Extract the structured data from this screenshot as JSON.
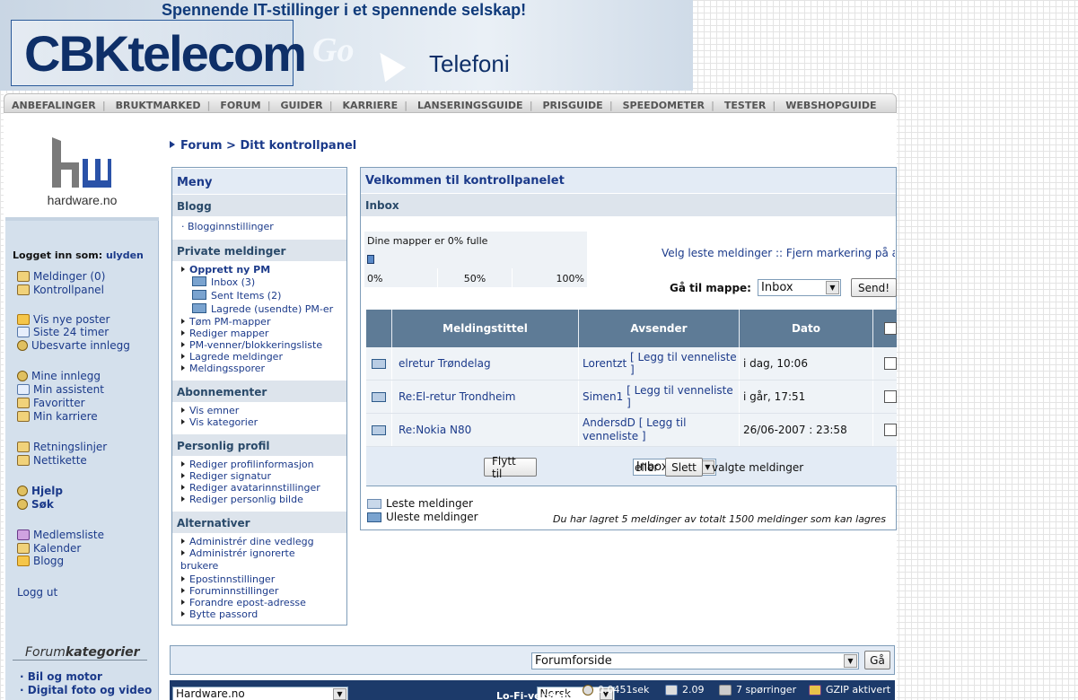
{
  "banner": {
    "tagline": "Spennende IT-stillinger i et spennende selskap!",
    "company": "CBKtelecom",
    "go": "Go",
    "product": "Telefoni"
  },
  "topnav": [
    "ANBEFALINGER",
    "BRUKTMARKED",
    "FORUM",
    "GUIDER",
    "KARRIERE",
    "LANSERINGSGUIDE",
    "PRISGUIDE",
    "SPEEDOMETER",
    "TESTER",
    "WEBSHOPGUIDE"
  ],
  "sidebar": {
    "logo_text": "hardware.no",
    "logged_in_label": "Logget inn som:",
    "username": "ulyden",
    "group1": [
      "Meldinger (0)",
      "Kontrollpanel"
    ],
    "group2": [
      "Vis nye poster",
      "Siste 24 timer",
      "Ubesvarte innlegg"
    ],
    "group3": [
      "Mine innlegg",
      "Min assistent",
      "Favoritter",
      "Min karriere"
    ],
    "group4": [
      "Retningslinjer",
      "Nettikette"
    ],
    "group5": [
      "Hjelp",
      "Søk"
    ],
    "group6": [
      "Medlemsliste",
      "Kalender",
      "Blogg"
    ],
    "logout": "Logg ut",
    "forumcat_title_a": "Forum",
    "forumcat_title_b": "kategorier",
    "forumcats": [
      "Bil og motor",
      "Digital foto og video"
    ]
  },
  "breadcrumb": {
    "root": "Forum",
    "sep": ">",
    "current": "Ditt kontrollpanel"
  },
  "menu": {
    "title": "Meny",
    "blogg": {
      "header": "Blogg",
      "items": [
        "Blogginnstillinger"
      ]
    },
    "pm": {
      "header": "Private meldinger",
      "new": "Opprett ny PM",
      "folders": [
        "Inbox (3)",
        "Sent Items (2)",
        "Lagrede (usendte) PM-er"
      ],
      "items": [
        "Tøm PM-mapper",
        "Rediger mapper",
        "PM-venner/blokkeringsliste",
        "Lagrede meldinger",
        "Meldingssporer"
      ]
    },
    "subs": {
      "header": "Abonnementer",
      "items": [
        "Vis emner",
        "Vis kategorier"
      ]
    },
    "profile": {
      "header": "Personlig profil",
      "items": [
        "Rediger profilinformasjon",
        "Rediger signatur",
        "Rediger avatarinnstillinger",
        "Rediger personlig bilde"
      ]
    },
    "alt": {
      "header": "Alternativer",
      "items": [
        "Administrér dine vedlegg",
        "Administrér ignorerte",
        "brukere",
        "Epostinnstillinger",
        "Foruminnstillinger",
        "Forandre epost-adresse",
        "Bytte passord"
      ]
    }
  },
  "main": {
    "title": "Velkommen til kontrollpanelet",
    "inbox_label": "Inbox",
    "quota_text": "Dine mapper er 0% fulle",
    "quota_fill": 0.02,
    "quota_scale": [
      "0%",
      "50%",
      "100%"
    ],
    "mark_links": "Velg leste meldinger :: Fjern markering på alle",
    "goto_label": "Gå til mappe:",
    "goto_value": "Inbox",
    "send_label": "Send!",
    "columns": [
      "Meldingstittel",
      "Avsender",
      "Dato"
    ],
    "rows": [
      {
        "title": "elretur Trøndelag",
        "sender": "Lorentzt",
        "buddy": "[ Legg til venneliste ]",
        "date": "i dag, 10:06"
      },
      {
        "title": "Re:El-retur Trondheim",
        "sender": "Simen1",
        "buddy": "[ Legg til venneliste ]",
        "date": "i går, 17:51"
      },
      {
        "title": "Re:Nokia N80",
        "sender": "AndersdD",
        "buddy": "[ Legg til",
        "buddy2": "venneliste ]",
        "date": "26/06-2007 : 23:58"
      }
    ],
    "move_label": "Flytt til",
    "move_value": "Inbox",
    "or_label": "eller",
    "delete_label": "Slett",
    "selected_label": "valgte meldinger",
    "legend_read": "Leste meldinger",
    "legend_unread": "Uleste meldinger",
    "storage_note": "Du har lagret 5 meldinger av totalt 1500 meldinger som kan lagres"
  },
  "bottombar": {
    "jump_value": "Forumforside",
    "go_label": "Gå"
  },
  "footer": {
    "site_select": "Hardware.no",
    "lang_select": "Norsk",
    "lofi": "Lo-Fi-version",
    "time": "0.0451sek",
    "load": "2.09",
    "queries": "7 spørringer",
    "gzip": "GZIP aktivert"
  }
}
